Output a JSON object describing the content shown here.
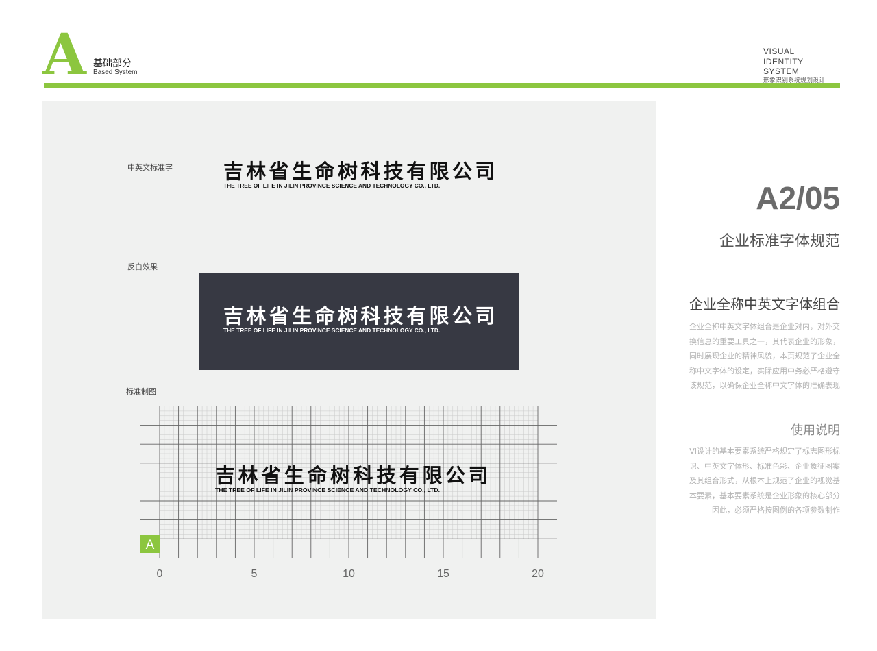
{
  "header": {
    "section_letter": "A",
    "section_cn": "基础部分",
    "section_en": "Based System",
    "system_line1": "VISUAL",
    "system_line2": "IDENTITY SYSTEM",
    "system_line3": "形象识别系统规划设计"
  },
  "panel": {
    "standard_label": "中英文标准字",
    "reverse_label": "反白效果",
    "grid_label": "标准制图",
    "company_cn": "吉林省生命树科技有限公司",
    "company_en": "THE TREE OF LIFE IN JILIN PROVINCE SCIENCE AND TECHNOLOGY CO., LTD.",
    "grid_unit_badge": "A",
    "grid_ticks": [
      "0",
      "5",
      "10",
      "15",
      "20"
    ],
    "grid_columns": 20
  },
  "sidebar": {
    "page_code": "A2/05",
    "page_title": "企业标准字体规范",
    "section1_title": "企业全称中英文字体组合",
    "section1_lines": [
      "企业全称中英文字体组合是企业对内，对外交",
      "换信息的重要工具之一，其代表企业的形象，",
      "同时展现企业的精神风貌，本页规范了企业全",
      "称中文字体的设定，实际应用中务必严格遵守",
      "该规范，以确保企业全称中文字体的准确表现"
    ],
    "section2_title": "使用说明",
    "section2_lines": [
      "VI设计的基本要素系统严格规定了标志图形标",
      "识、中英文字体形、标准色彩、企业象征图案",
      "及其组合形式，从根本上规范了企业的视觉基",
      "本要素，基本要素系统是企业形象的核心部分",
      "因此，必须严格按图例的各项参数制作"
    ]
  },
  "colors": {
    "accent_green": "#8cc63f",
    "panel_gray": "#f0f1f0",
    "dark_box": "#373943"
  }
}
